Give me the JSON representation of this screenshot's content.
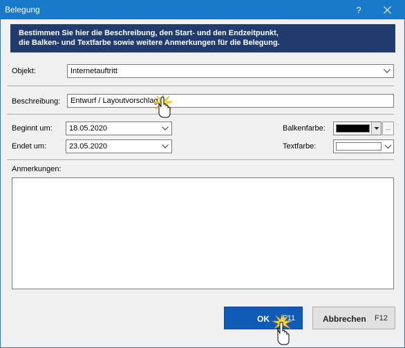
{
  "window": {
    "title": "Belegung",
    "help_label": "?"
  },
  "banner": {
    "line1": "Bestimmen Sie hier die Beschreibung, den Start- und den Endzeitpunkt,",
    "line2": "die Balken- und Textfarbe sowie weitere Anmerkungen für die Belegung."
  },
  "form": {
    "objekt_label": "Objekt:",
    "objekt_value": "Internetauftritt",
    "beschreibung_label": "Beschreibung:",
    "beschreibung_value": "Entwurf / Layoutvorschlag",
    "beginnt_label": "Beginnt um:",
    "beginnt_value": "18.05.2020",
    "endet_label": "Endet um:",
    "endet_value": "23.05.2020",
    "balkenfarbe_label": "Balkenfarbe:",
    "balkenfarbe_color": "#000000",
    "balkenfarbe_more": "...",
    "textfarbe_label": "Textfarbe:",
    "textfarbe_color": "#ffffff",
    "anmerkungen_label": "Anmerkungen:",
    "anmerkungen_value": ""
  },
  "buttons": {
    "ok_label": "OK",
    "ok_key": "F11",
    "cancel_label": "Abbrechen",
    "cancel_key": "F12"
  },
  "colors": {
    "titlebar": "#1979ca",
    "banner": "#213b6e",
    "ok_button": "#0f5bb6"
  }
}
